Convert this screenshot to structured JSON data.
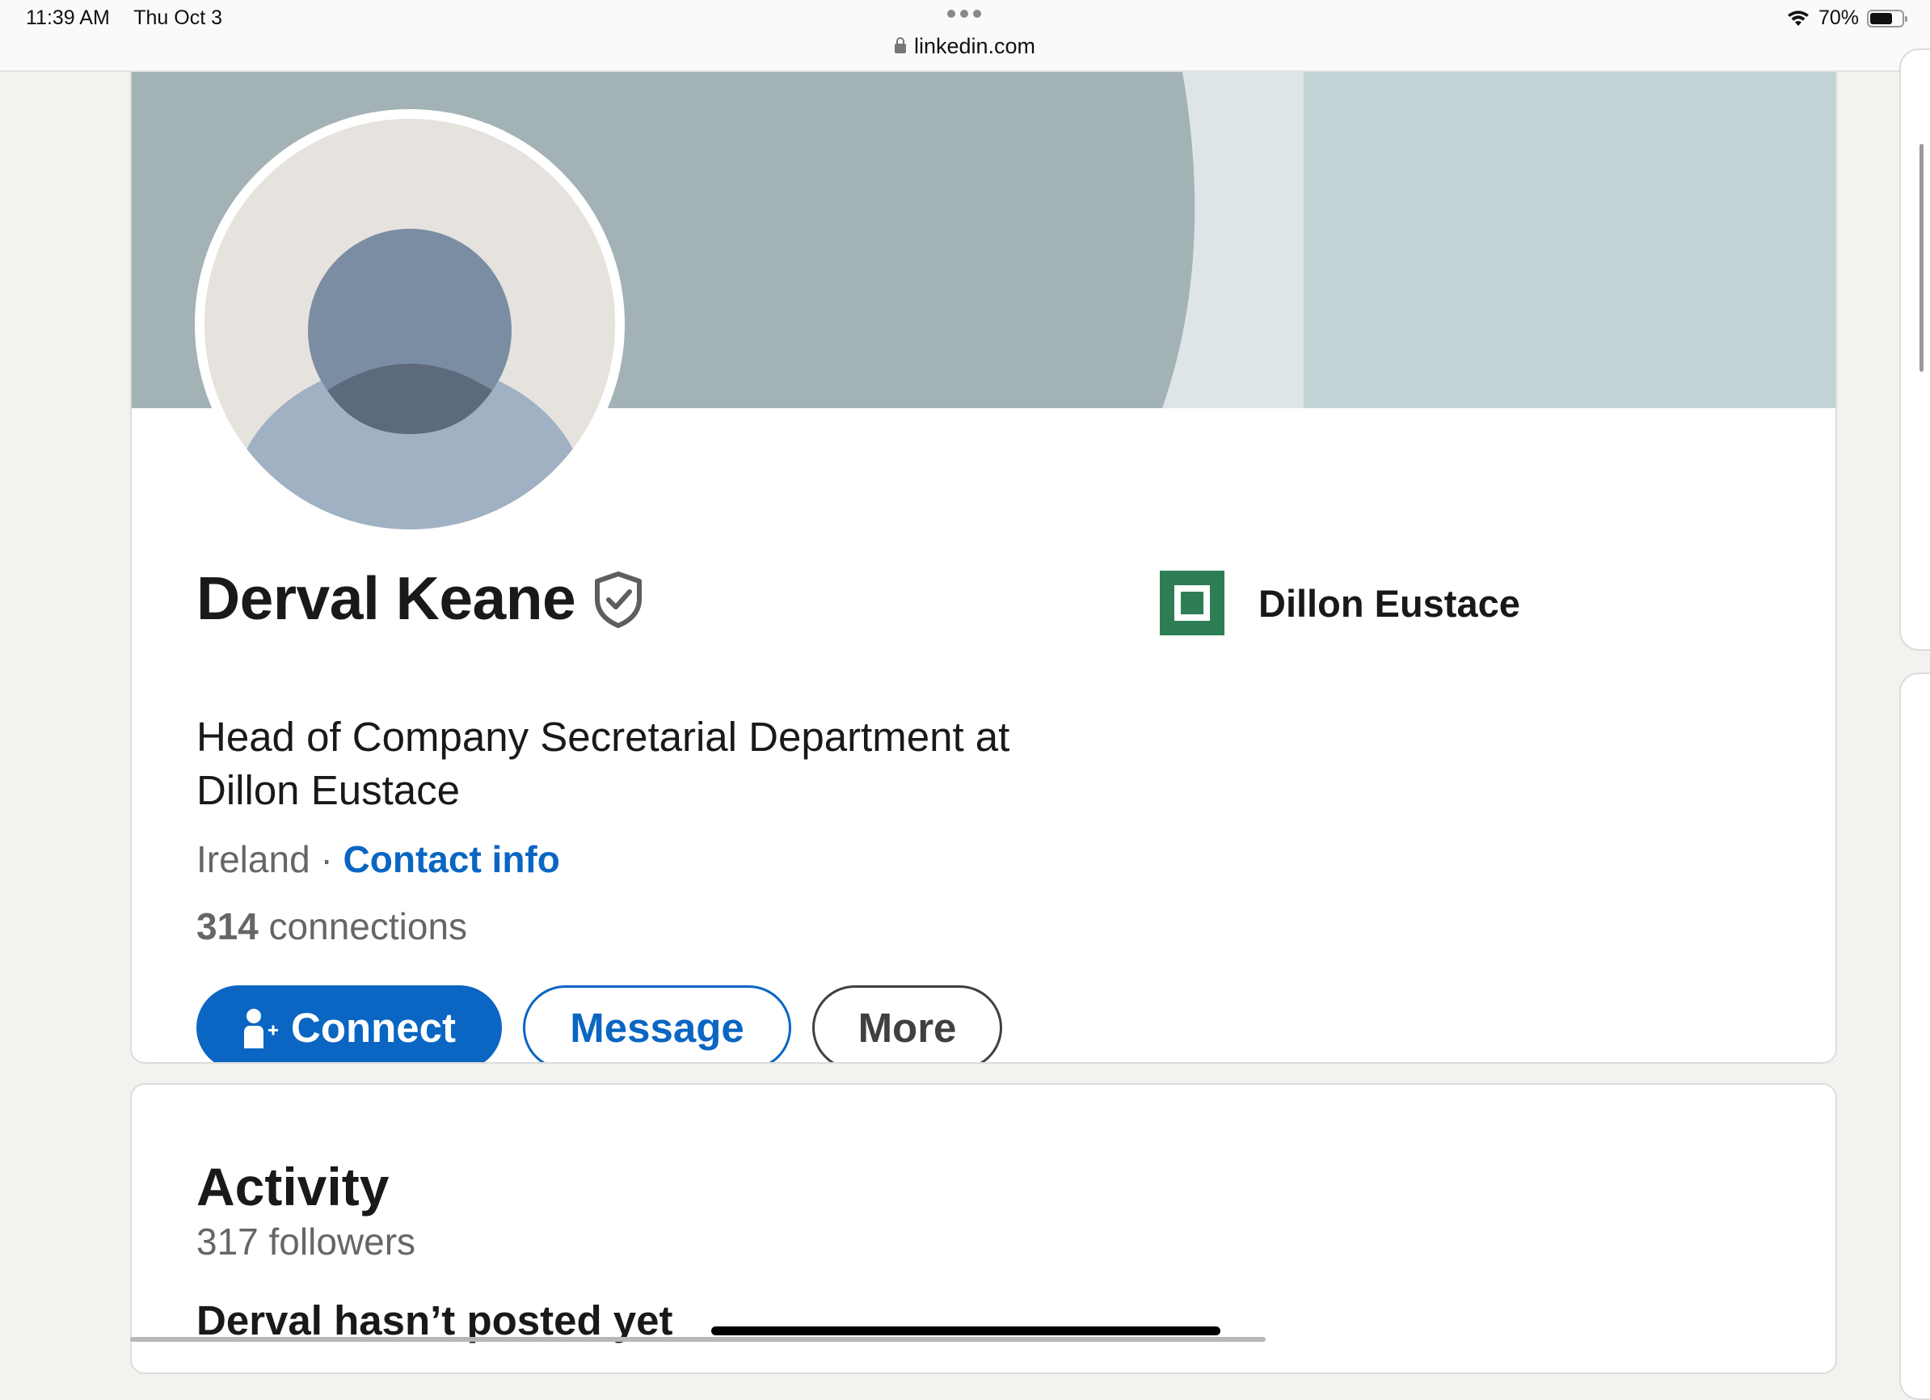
{
  "status_bar": {
    "time": "11:39 AM",
    "date": "Thu Oct 3",
    "battery": "70%",
    "url": "linkedin.com"
  },
  "profile": {
    "name": "Derval Keane",
    "headline": "Head of Company Secretarial Department at Dillon Eustace",
    "location": "Ireland",
    "separator": "·",
    "contact_info_label": "Contact info",
    "connections_count": "314",
    "connections_label": "connections",
    "company_name": "Dillon Eustace"
  },
  "actions": {
    "connect_label": "Connect",
    "message_label": "Message",
    "more_label": "More"
  },
  "activity": {
    "title": "Activity",
    "followers": "317 followers",
    "empty_text": "Derval hasn’t posted yet"
  },
  "icons": {
    "lock": "lock-icon",
    "wifi": "wifi-icon",
    "battery": "battery-icon",
    "verified": "verified-shield-icon",
    "connect": "add-person-icon",
    "company_logo": "company-logo-icon"
  },
  "colors": {
    "brand_blue": "#0a66c2",
    "banner": "#a3b2b5",
    "company_green": "#2e7d55"
  }
}
